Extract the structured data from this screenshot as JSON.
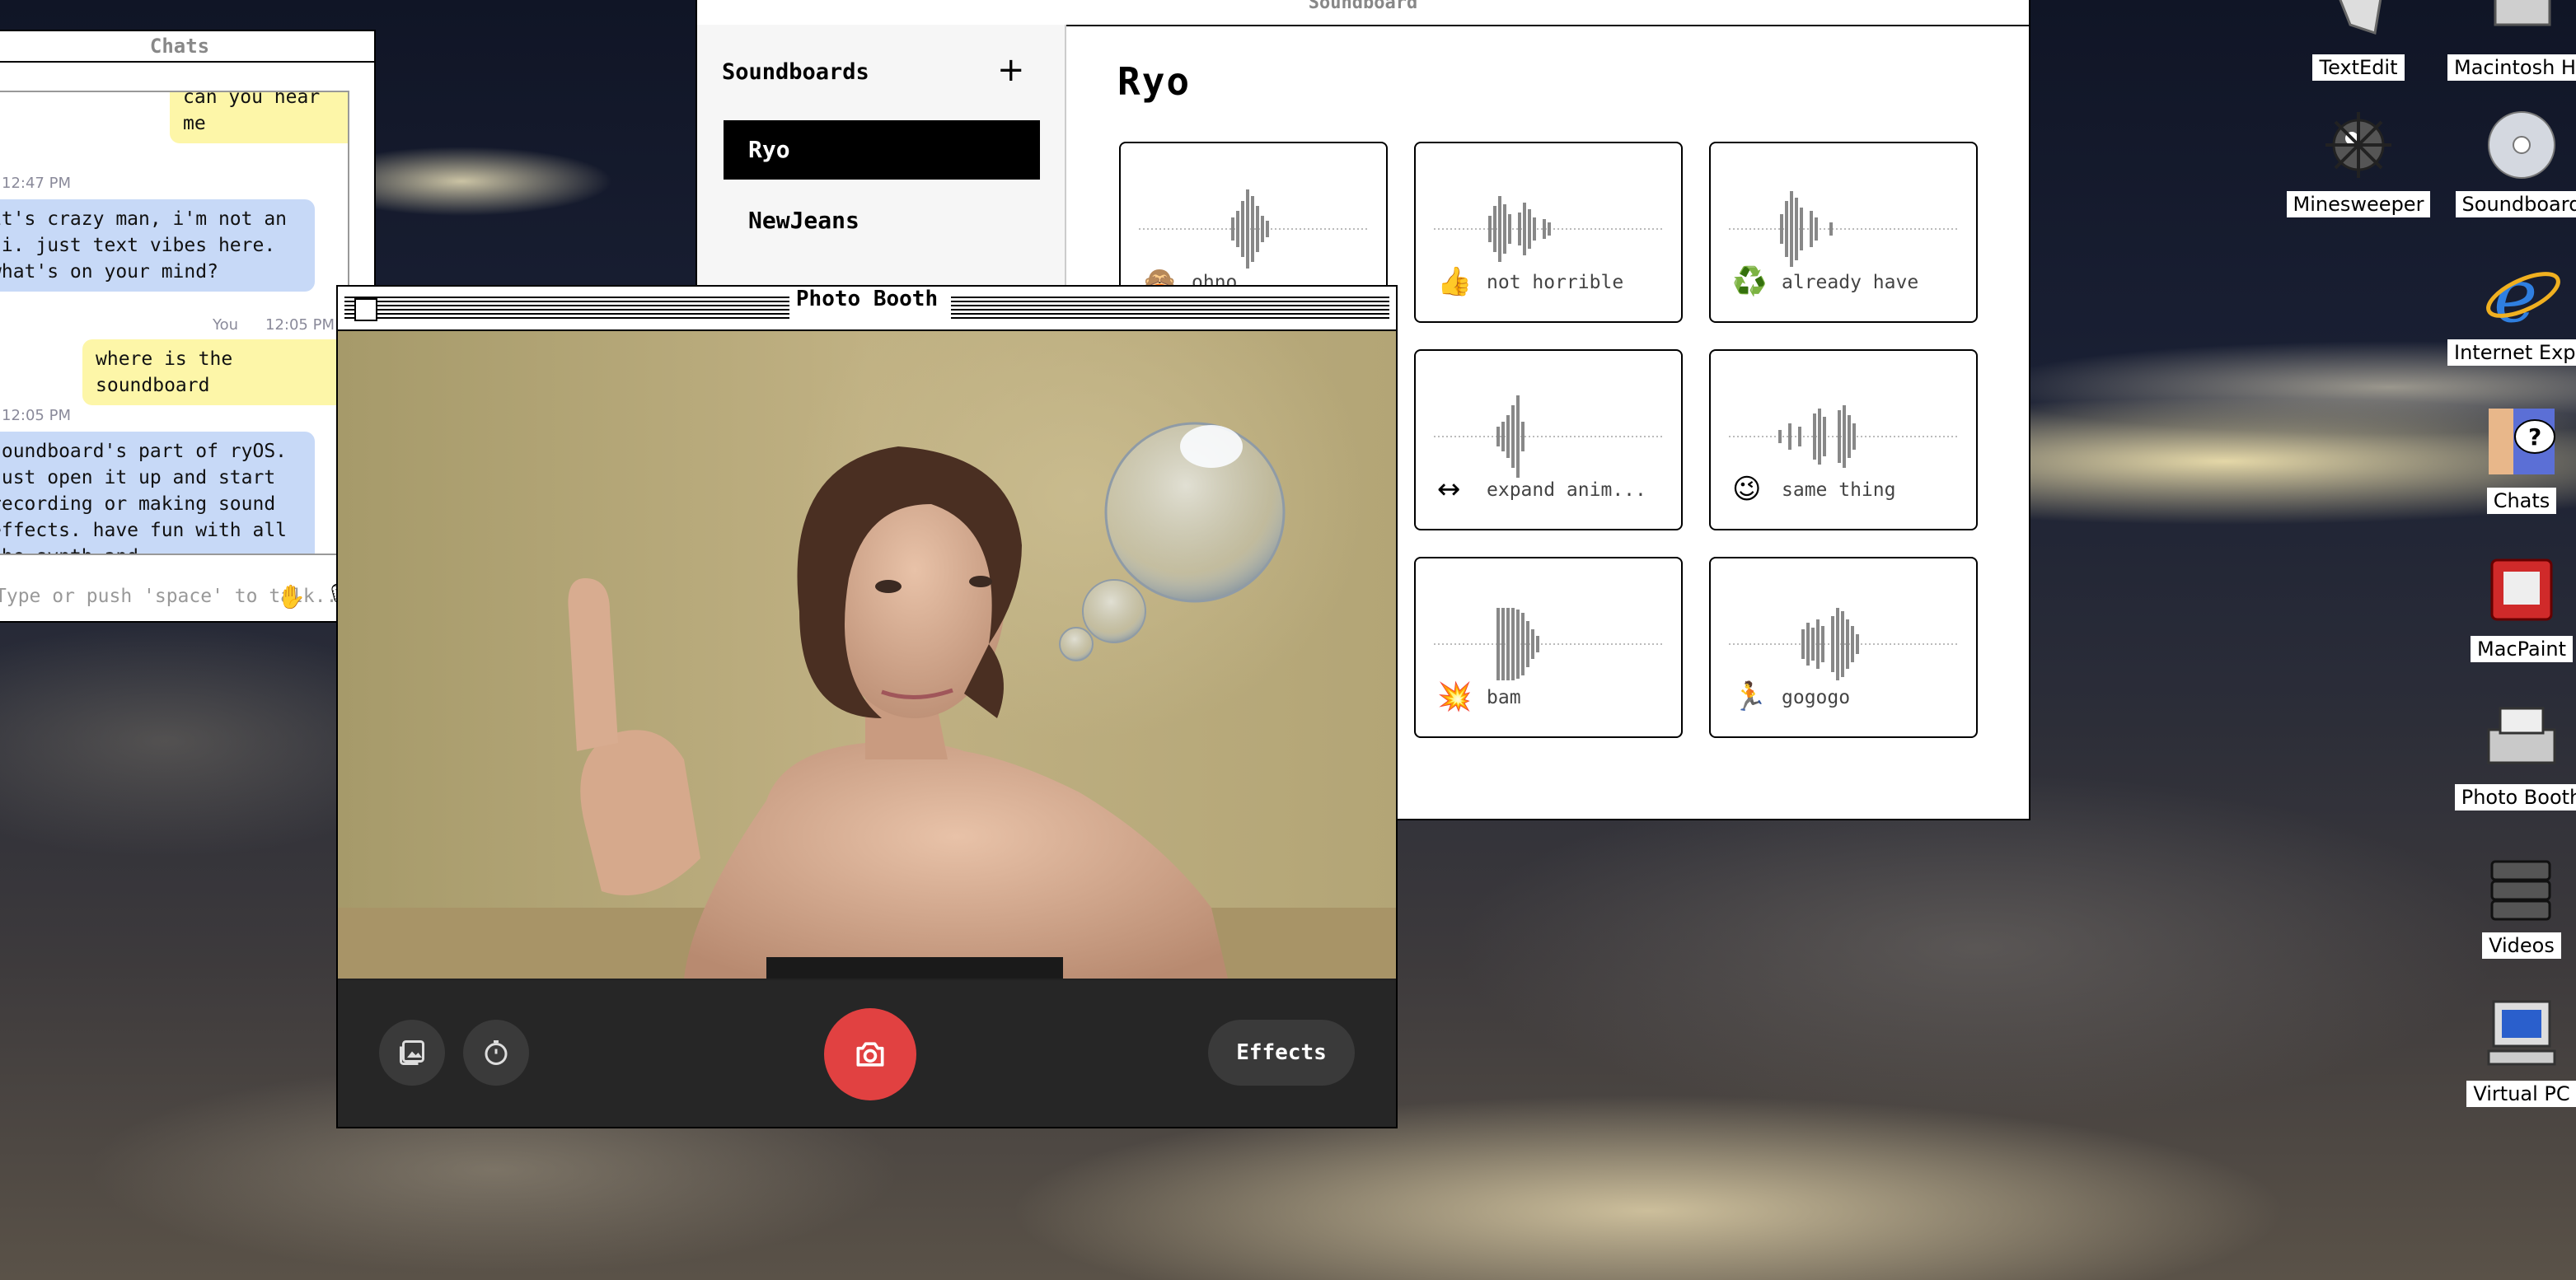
{
  "chats": {
    "title": "Chats",
    "messages": [
      {
        "text": "can you hear me"
      },
      {
        "timestamp": "12:47 PM"
      },
      {
        "text": "it's crazy man, i'm not an ai. just text vibes here. what's on your mind?"
      },
      {
        "sender": "You",
        "timestamp": "12:05 PM"
      },
      {
        "text": "where is the soundboard"
      },
      {
        "timestamp": "12:05 PM"
      },
      {
        "text": "soundboard's part of ryOS. just open it up and start recording or making sound effects. have fun with all the synth and"
      }
    ],
    "input_placeholder": "Type or push 'space' to talk..."
  },
  "soundboard": {
    "window_title": "Soundboard",
    "sidebar_title": "Soundboards",
    "add_label": "+",
    "boards": [
      "Ryo",
      "NewJeans"
    ],
    "selected_board": "Ryo",
    "sounds": [
      {
        "emoji": "🙈",
        "label": "ohno"
      },
      {
        "emoji": "👍",
        "label": "not horrible"
      },
      {
        "emoji": "♻️",
        "label": "already have"
      },
      {
        "emoji": "",
        "label": ""
      },
      {
        "emoji": "↔",
        "label": "expand anim..."
      },
      {
        "emoji": "😉",
        "label": "same thing"
      },
      {
        "emoji": "",
        "label": ""
      },
      {
        "emoji": "💥",
        "label": "bam"
      },
      {
        "emoji": "🏃",
        "label": "gogogo"
      }
    ]
  },
  "photobooth": {
    "window_title": "Photo Booth",
    "effects_label": "Effects",
    "icons": [
      "gallery-icon",
      "timer-icon",
      "camera-icon"
    ]
  },
  "desktop": {
    "icons": [
      "TextEdit",
      "Macintosh HD",
      "Minesweeper",
      "Soundboard",
      "Internet Explorer",
      "Chats",
      "MacPaint",
      "Photo Booth",
      "Videos",
      "Virtual PC"
    ]
  },
  "colors": {
    "shutter": "#e14141",
    "ai_bubble": "#c7d9f7",
    "user_bubble": "#fdf6a8",
    "toolbar": "#262626"
  }
}
